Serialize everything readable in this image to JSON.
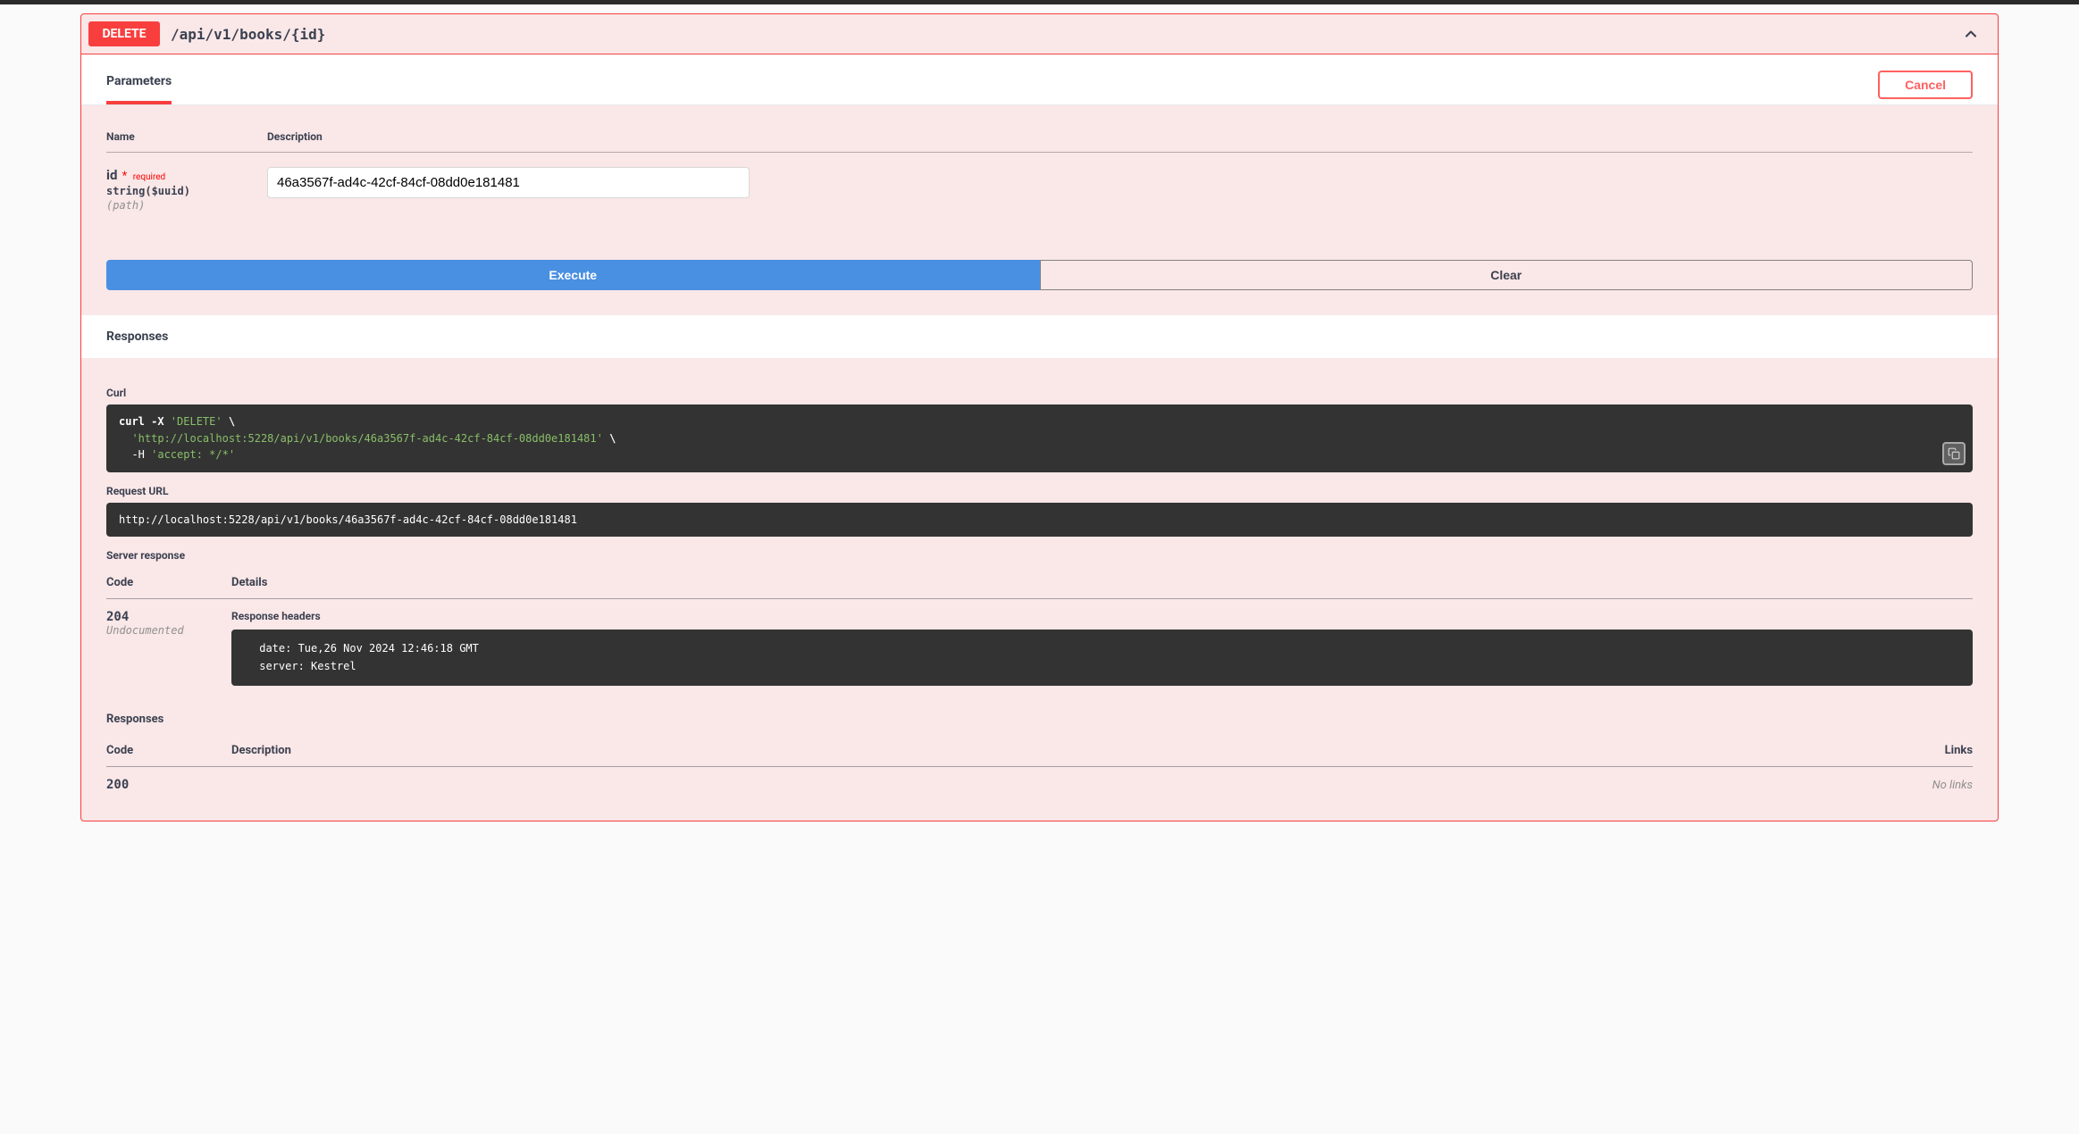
{
  "summary": {
    "method": "DELETE",
    "path": "/api/v1/books/{id}"
  },
  "parameters": {
    "tab_label": "Parameters",
    "cancel_label": "Cancel",
    "col_name": "Name",
    "col_description": "Description",
    "items": [
      {
        "name": "id",
        "required_label": "required",
        "type": "string($uuid)",
        "in": "(path)",
        "value": "46a3567f-ad4c-42cf-84cf-08dd0e181481"
      }
    ],
    "execute_label": "Execute",
    "clear_label": "Clear"
  },
  "responses_header": "Responses",
  "curl": {
    "label": "Curl",
    "cmd_prefix": "curl -X ",
    "method_str": "'DELETE'",
    "backslash": " \\",
    "url_line_indent": "  ",
    "url_str": "'http://localhost:5228/api/v1/books/46a3567f-ad4c-42cf-84cf-08dd0e181481'",
    "header_line_indent": "  -H ",
    "header_str": "'accept: */*'"
  },
  "request_url": {
    "label": "Request URL",
    "value": "http://localhost:5228/api/v1/books/46a3567f-ad4c-42cf-84cf-08dd0e181481"
  },
  "server_response": {
    "label": "Server response",
    "col_code": "Code",
    "col_details": "Details",
    "status_code": "204",
    "undocumented": "Undocumented",
    "headers_label": "Response headers",
    "headers_text": " date: Tue,26 Nov 2024 12:46:18 GMT \n server: Kestrel "
  },
  "responses_list": {
    "label": "Responses",
    "col_code": "Code",
    "col_description": "Description",
    "col_links": "Links",
    "items": [
      {
        "code": "200",
        "nolinks": "No links"
      }
    ]
  }
}
